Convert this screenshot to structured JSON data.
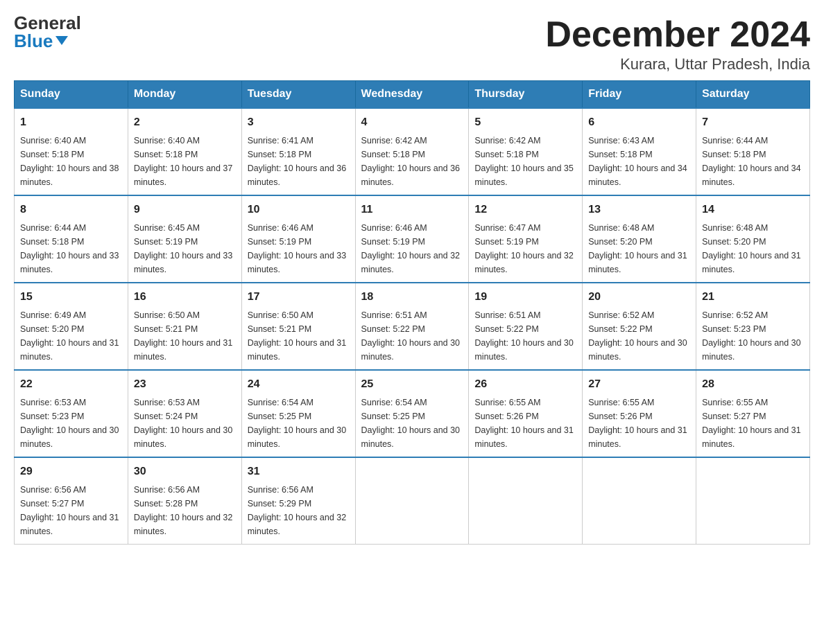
{
  "header": {
    "logo_general": "General",
    "logo_blue": "Blue",
    "month_title": "December 2024",
    "location": "Kurara, Uttar Pradesh, India"
  },
  "days_of_week": [
    "Sunday",
    "Monday",
    "Tuesday",
    "Wednesday",
    "Thursday",
    "Friday",
    "Saturday"
  ],
  "weeks": [
    [
      {
        "day": "1",
        "sunrise": "Sunrise: 6:40 AM",
        "sunset": "Sunset: 5:18 PM",
        "daylight": "Daylight: 10 hours and 38 minutes."
      },
      {
        "day": "2",
        "sunrise": "Sunrise: 6:40 AM",
        "sunset": "Sunset: 5:18 PM",
        "daylight": "Daylight: 10 hours and 37 minutes."
      },
      {
        "day": "3",
        "sunrise": "Sunrise: 6:41 AM",
        "sunset": "Sunset: 5:18 PM",
        "daylight": "Daylight: 10 hours and 36 minutes."
      },
      {
        "day": "4",
        "sunrise": "Sunrise: 6:42 AM",
        "sunset": "Sunset: 5:18 PM",
        "daylight": "Daylight: 10 hours and 36 minutes."
      },
      {
        "day": "5",
        "sunrise": "Sunrise: 6:42 AM",
        "sunset": "Sunset: 5:18 PM",
        "daylight": "Daylight: 10 hours and 35 minutes."
      },
      {
        "day": "6",
        "sunrise": "Sunrise: 6:43 AM",
        "sunset": "Sunset: 5:18 PM",
        "daylight": "Daylight: 10 hours and 34 minutes."
      },
      {
        "day": "7",
        "sunrise": "Sunrise: 6:44 AM",
        "sunset": "Sunset: 5:18 PM",
        "daylight": "Daylight: 10 hours and 34 minutes."
      }
    ],
    [
      {
        "day": "8",
        "sunrise": "Sunrise: 6:44 AM",
        "sunset": "Sunset: 5:18 PM",
        "daylight": "Daylight: 10 hours and 33 minutes."
      },
      {
        "day": "9",
        "sunrise": "Sunrise: 6:45 AM",
        "sunset": "Sunset: 5:19 PM",
        "daylight": "Daylight: 10 hours and 33 minutes."
      },
      {
        "day": "10",
        "sunrise": "Sunrise: 6:46 AM",
        "sunset": "Sunset: 5:19 PM",
        "daylight": "Daylight: 10 hours and 33 minutes."
      },
      {
        "day": "11",
        "sunrise": "Sunrise: 6:46 AM",
        "sunset": "Sunset: 5:19 PM",
        "daylight": "Daylight: 10 hours and 32 minutes."
      },
      {
        "day": "12",
        "sunrise": "Sunrise: 6:47 AM",
        "sunset": "Sunset: 5:19 PM",
        "daylight": "Daylight: 10 hours and 32 minutes."
      },
      {
        "day": "13",
        "sunrise": "Sunrise: 6:48 AM",
        "sunset": "Sunset: 5:20 PM",
        "daylight": "Daylight: 10 hours and 31 minutes."
      },
      {
        "day": "14",
        "sunrise": "Sunrise: 6:48 AM",
        "sunset": "Sunset: 5:20 PM",
        "daylight": "Daylight: 10 hours and 31 minutes."
      }
    ],
    [
      {
        "day": "15",
        "sunrise": "Sunrise: 6:49 AM",
        "sunset": "Sunset: 5:20 PM",
        "daylight": "Daylight: 10 hours and 31 minutes."
      },
      {
        "day": "16",
        "sunrise": "Sunrise: 6:50 AM",
        "sunset": "Sunset: 5:21 PM",
        "daylight": "Daylight: 10 hours and 31 minutes."
      },
      {
        "day": "17",
        "sunrise": "Sunrise: 6:50 AM",
        "sunset": "Sunset: 5:21 PM",
        "daylight": "Daylight: 10 hours and 31 minutes."
      },
      {
        "day": "18",
        "sunrise": "Sunrise: 6:51 AM",
        "sunset": "Sunset: 5:22 PM",
        "daylight": "Daylight: 10 hours and 30 minutes."
      },
      {
        "day": "19",
        "sunrise": "Sunrise: 6:51 AM",
        "sunset": "Sunset: 5:22 PM",
        "daylight": "Daylight: 10 hours and 30 minutes."
      },
      {
        "day": "20",
        "sunrise": "Sunrise: 6:52 AM",
        "sunset": "Sunset: 5:22 PM",
        "daylight": "Daylight: 10 hours and 30 minutes."
      },
      {
        "day": "21",
        "sunrise": "Sunrise: 6:52 AM",
        "sunset": "Sunset: 5:23 PM",
        "daylight": "Daylight: 10 hours and 30 minutes."
      }
    ],
    [
      {
        "day": "22",
        "sunrise": "Sunrise: 6:53 AM",
        "sunset": "Sunset: 5:23 PM",
        "daylight": "Daylight: 10 hours and 30 minutes."
      },
      {
        "day": "23",
        "sunrise": "Sunrise: 6:53 AM",
        "sunset": "Sunset: 5:24 PM",
        "daylight": "Daylight: 10 hours and 30 minutes."
      },
      {
        "day": "24",
        "sunrise": "Sunrise: 6:54 AM",
        "sunset": "Sunset: 5:25 PM",
        "daylight": "Daylight: 10 hours and 30 minutes."
      },
      {
        "day": "25",
        "sunrise": "Sunrise: 6:54 AM",
        "sunset": "Sunset: 5:25 PM",
        "daylight": "Daylight: 10 hours and 30 minutes."
      },
      {
        "day": "26",
        "sunrise": "Sunrise: 6:55 AM",
        "sunset": "Sunset: 5:26 PM",
        "daylight": "Daylight: 10 hours and 31 minutes."
      },
      {
        "day": "27",
        "sunrise": "Sunrise: 6:55 AM",
        "sunset": "Sunset: 5:26 PM",
        "daylight": "Daylight: 10 hours and 31 minutes."
      },
      {
        "day": "28",
        "sunrise": "Sunrise: 6:55 AM",
        "sunset": "Sunset: 5:27 PM",
        "daylight": "Daylight: 10 hours and 31 minutes."
      }
    ],
    [
      {
        "day": "29",
        "sunrise": "Sunrise: 6:56 AM",
        "sunset": "Sunset: 5:27 PM",
        "daylight": "Daylight: 10 hours and 31 minutes."
      },
      {
        "day": "30",
        "sunrise": "Sunrise: 6:56 AM",
        "sunset": "Sunset: 5:28 PM",
        "daylight": "Daylight: 10 hours and 32 minutes."
      },
      {
        "day": "31",
        "sunrise": "Sunrise: 6:56 AM",
        "sunset": "Sunset: 5:29 PM",
        "daylight": "Daylight: 10 hours and 32 minutes."
      },
      null,
      null,
      null,
      null
    ]
  ]
}
